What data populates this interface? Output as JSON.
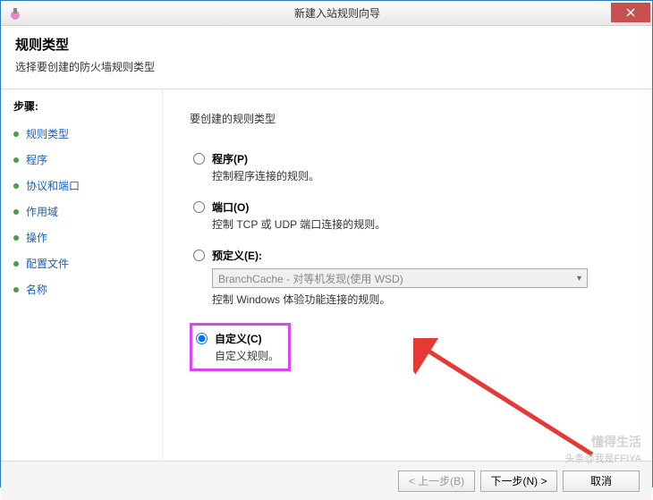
{
  "titlebar": {
    "title": "新建入站规则向导"
  },
  "header": {
    "title": "规则类型",
    "subtitle": "选择要创建的防火墙规则类型"
  },
  "sidebar": {
    "steps_label": "步骤:",
    "items": [
      {
        "label": "规则类型"
      },
      {
        "label": "程序"
      },
      {
        "label": "协议和端口"
      },
      {
        "label": "作用域"
      },
      {
        "label": "操作"
      },
      {
        "label": "配置文件"
      },
      {
        "label": "名称"
      }
    ]
  },
  "content": {
    "title": "要创建的规则类型",
    "options": {
      "program": {
        "label": "程序(P)",
        "desc": "控制程序连接的规则。"
      },
      "port": {
        "label": "端口(O)",
        "desc": "控制 TCP 或 UDP 端口连接的规则。"
      },
      "predefined": {
        "label": "预定义(E):",
        "desc": "控制 Windows 体验功能连接的规则。",
        "dropdown": "BranchCache - 对等机发现(使用 WSD)"
      },
      "custom": {
        "label": "自定义(C)",
        "desc": "自定义规则。"
      }
    }
  },
  "footer": {
    "back": "< 上一步(B)",
    "next": "下一步(N) >",
    "cancel": "取消"
  },
  "watermark": {
    "main": "懂得生活",
    "sub": "头条@我是FFIYA"
  }
}
